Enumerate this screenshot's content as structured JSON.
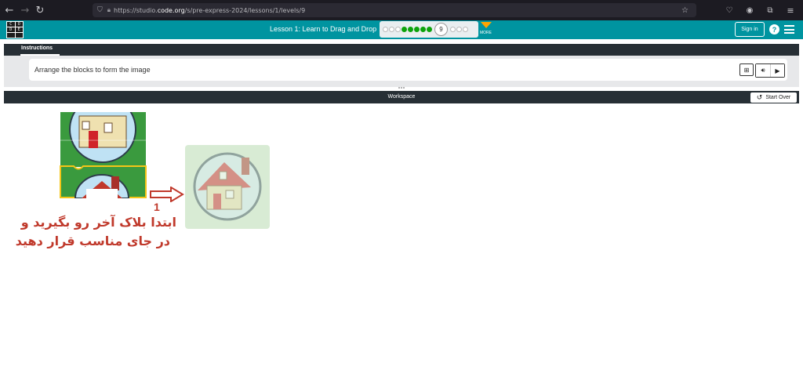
{
  "browser": {
    "url_prefix": "https://studio.",
    "url_domain": "code.org",
    "url_suffix": "/s/pre-express-2024/lessons/1/levels/9"
  },
  "header": {
    "logo_letters": [
      "C",
      "O",
      "D",
      "E",
      "",
      ""
    ],
    "lesson_title": "Lesson 1: Learn to Drag and Drop",
    "progress": {
      "dots_before": [
        "empty",
        "empty",
        "empty",
        "done",
        "done",
        "done",
        "done",
        "done"
      ],
      "current_level": "9",
      "dots_after": [
        "empty",
        "empty",
        "empty"
      ]
    },
    "more_label": "MORE",
    "signin_label": "Sign in",
    "help_label": "?"
  },
  "instructions": {
    "tab_label": "Instructions",
    "text": "Arrange the blocks to form the image"
  },
  "workspace": {
    "title": "Workspace",
    "start_over_label": "Start Over"
  },
  "annotation": {
    "step_number": "1",
    "line1": "ابتدا بلاک آخر رو بگیرید و",
    "line2": "در جای مناسب قرار دهید"
  },
  "colors": {
    "accent": "#0094a0",
    "annotation": "#c0392b",
    "piece_green": "#3a9a3e",
    "piece_selected": "#f5c518"
  }
}
